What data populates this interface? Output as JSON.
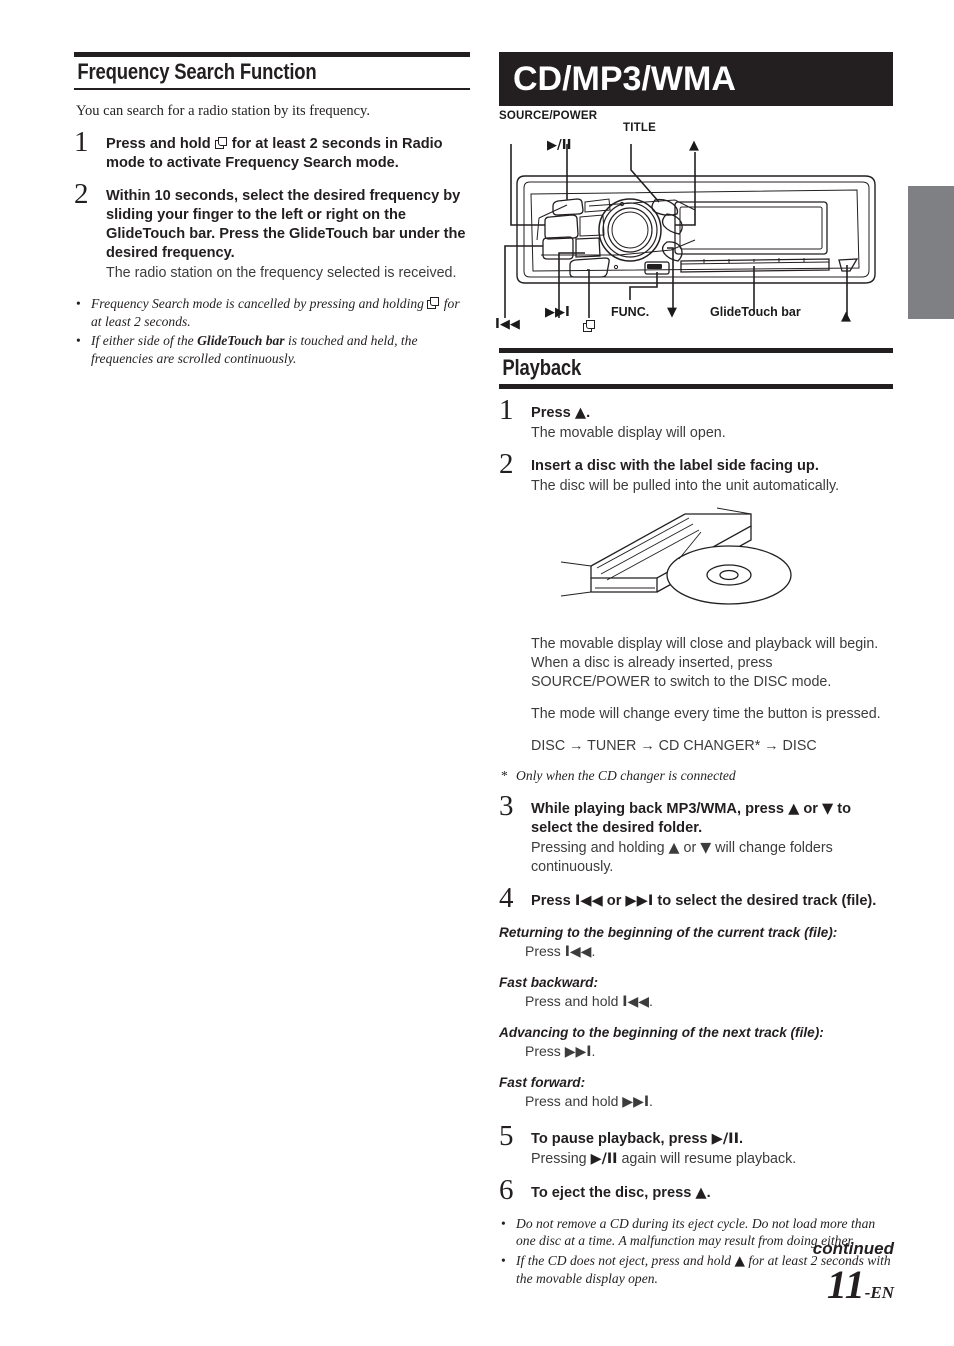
{
  "left_column": {
    "heading": "Frequency Search Function",
    "lead": "You can search for a radio station by its frequency.",
    "steps": [
      {
        "num": "1",
        "title_a": "Press and hold ",
        "title_b": " for at least 2 seconds in Radio mode to activate Frequency Search mode."
      },
      {
        "num": "2",
        "title_a": "Within 10 seconds, select the desired frequency by sliding your finger to the left or right on the ",
        "bold_term": "GlideTouch bar",
        "title_b": ". Press the ",
        "bold_term2": "GlideTouch bar",
        "title_c": " under the desired frequency.",
        "desc": "The radio station on the frequency selected is received."
      }
    ],
    "notes": [
      {
        "bullet": "•",
        "text_a": "Frequency Search mode is cancelled by pressing and holding ",
        "text_b": " for at least 2 seconds."
      },
      {
        "bullet": "•",
        "text_a": "If either side of the ",
        "bold_term": "GlideTouch bar",
        "text_b": " is touched and held, the frequencies are scrolled continuously."
      }
    ]
  },
  "right_column": {
    "banner_title": "CD/MP3/WMA",
    "diagram": {
      "labels": {
        "source_power": "SOURCE/POWER",
        "title": "TITLE",
        "play_pause": "▶/II",
        "up_arrow": "▲",
        "down_arrow": "▼",
        "prev_track": "I◀◀",
        "next_track": "▶▶I",
        "func": "FUNC.",
        "glidetouch_bar": "GlideTouch bar",
        "eject": "▲",
        "display_button": "display-icon"
      }
    },
    "playback_heading": "Playback",
    "steps": [
      {
        "num": "1",
        "title_a": "Press ",
        "glyph": "▲",
        "title_b": ".",
        "desc": "The movable display will open."
      },
      {
        "num": "2",
        "title": "Insert a disc with the label side facing up.",
        "desc": "The disc will be pulled into the unit automatically.",
        "after_figure_lines": [
          "The movable display will close and playback will begin. When a disc is already inserted, press SOURCE/POWER to switch to the DISC mode.",
          "The mode will change every time the button is pressed."
        ],
        "mode_sequence": "DISC → TUNER → CD CHANGER* → DISC",
        "star_note": "Only when the CD changer is connected",
        "star_mark": "*"
      },
      {
        "num": "3",
        "title_a": "While playing back MP3/WMA, press ",
        "up": "▲",
        "title_mid": " or ",
        "down": "▼",
        "title_b": " to select the desired folder.",
        "desc_a": "Pressing and holding ",
        "desc_b": " will change folders continuously."
      },
      {
        "num": "4",
        "title_a": "Press ",
        "prev": "I◀◀",
        "title_mid": " or ",
        "next": "▶▶I",
        "title_b": " to select the desired track (file)."
      },
      {
        "num": "5",
        "title_a": "To pause playback, press ",
        "glyph": "▶/II",
        "title_b": ".",
        "desc_a": "Pressing ",
        "desc_b": " again will resume playback."
      },
      {
        "num": "6",
        "title_a": "To eject the disc, press ",
        "glyph": "▲",
        "title_b": "."
      }
    ],
    "operations": [
      {
        "head": "Returning to the beginning of the current track (file):",
        "body_a": "Press ",
        "glyph": "I◀◀",
        "body_b": "."
      },
      {
        "head": "Fast backward:",
        "body_a": "Press and hold ",
        "glyph": "I◀◀",
        "body_b": "."
      },
      {
        "head": "Advancing to the beginning of the next track (file):",
        "body_a": "Press ",
        "glyph": "▶▶I",
        "body_b": "."
      },
      {
        "head": "Fast forward:",
        "body_a": "Press and hold ",
        "glyph": "▶▶I",
        "body_b": "."
      }
    ],
    "final_notes": [
      {
        "bullet": "•",
        "text": "Do not remove a CD during its eject cycle. Do not load more than one disc at a time. A malfunction may result from doing either."
      },
      {
        "bullet": "•",
        "text_a": "If the CD does not eject, press and hold ",
        "glyph": "▲",
        "text_b": " for at least 2 seconds with the movable display open."
      }
    ]
  },
  "footer": {
    "continued": "continued",
    "page_number": "11",
    "page_suffix": "-EN"
  },
  "colors": {
    "ink": "#231f20",
    "body_text": "#3c3c3c",
    "tab_gray": "#7e8084",
    "banner_bg": "#231f20",
    "banner_text": "#ffffff"
  }
}
